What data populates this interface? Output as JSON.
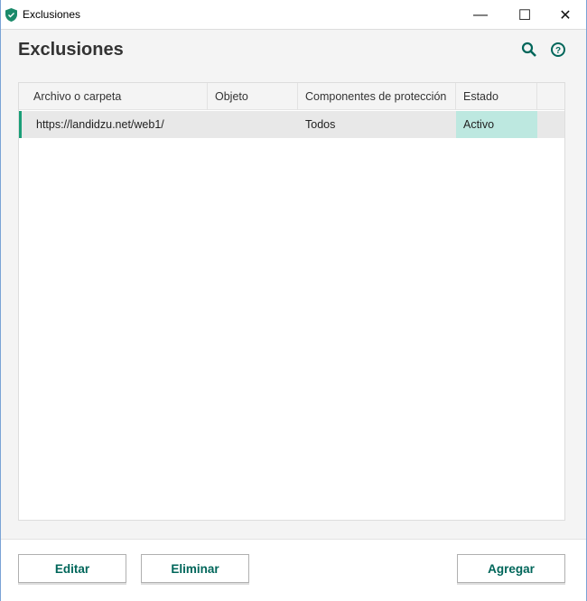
{
  "window": {
    "title": "Exclusiones",
    "minimize": "—",
    "maximize": "☐",
    "close": "✕"
  },
  "header": {
    "title": "Exclusiones"
  },
  "table": {
    "columns": [
      "Archivo o carpeta",
      "Objeto",
      "Componentes de protección",
      "Estado"
    ],
    "rows": [
      {
        "path": "https://landidzu.net/web1/",
        "object": "",
        "components": "Todos",
        "status": "Activo"
      }
    ]
  },
  "buttons": {
    "edit": "Editar",
    "delete": "Eliminar",
    "add": "Agregar"
  },
  "colors": {
    "accent": "#00665a",
    "active_bg": "#bde8e0"
  }
}
